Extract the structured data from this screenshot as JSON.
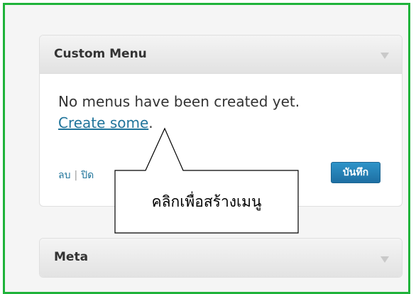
{
  "custom_menu_widget": {
    "title": "Custom Menu",
    "message": "No menus have been created yet.",
    "create_link": "Create some",
    "after_link": ".",
    "delete_label": "ลบ",
    "separator": "|",
    "close_label": "ปิด",
    "save_label": "บันทึก"
  },
  "meta_widget": {
    "title": "Meta"
  },
  "callout": {
    "text": "คลิกเพื่อสร้างเมนู"
  },
  "colors": {
    "frame_border": "#1fb33a",
    "link": "#21759b",
    "save_button": "#2581b8"
  },
  "icons": {
    "toggle": "triangle-down-icon"
  }
}
